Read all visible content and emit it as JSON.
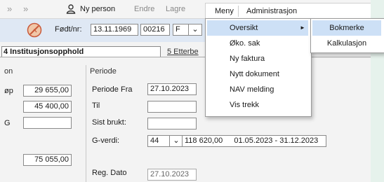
{
  "toolbar": {
    "back_icon": "double-chevron-right-icon",
    "forward_icon": "double-chevron-right-icon",
    "person_icon": "person-icon",
    "new_person": "Ny person",
    "edit": "Endre",
    "save": "Lagre"
  },
  "menubar": {
    "menu": "Meny",
    "admin": "Administrasjon"
  },
  "menu": {
    "items": [
      "Oversikt",
      "Øko. sak",
      "Ny faktura",
      "Nytt dokument",
      "NAV melding",
      "Vis trekk"
    ],
    "arrow": "►"
  },
  "submenu": {
    "items": [
      "Bokmerke",
      "Kalkulasjon"
    ]
  },
  "person": {
    "dob_label": "Født/nr:",
    "dob_value": "13.11.1969",
    "nr_value": "00216",
    "gender_value": "F",
    "dropdown_arrow": "⌄",
    "status_icon": "blocked-icon"
  },
  "tabs": {
    "active": "4 Institusjonsopphold",
    "second": "5 Etterbe"
  },
  "left": {
    "header": "on",
    "labels": [
      "øp",
      "G"
    ],
    "values": [
      "29 655,00",
      "45 400,00",
      "",
      "75 055,00"
    ]
  },
  "periode": {
    "header": "Periode",
    "fra_label": "Periode Fra",
    "fra_value": "27.10.2023",
    "til_label": "Til",
    "til_value": "",
    "sist_label": "Sist brukt:",
    "sist_value": "",
    "gverdi_label": "G-verdi:",
    "gverdi_code": "44",
    "gverdi_amount": "118 620,00",
    "gverdi_range": "01.05.2023 - 31.12.2023",
    "reg_label": "Reg. Dato",
    "reg_value": "27.10.2023"
  },
  "colors": {
    "accent": "#cde0f6",
    "toolbar": "#f4f4f4",
    "page": "#f3f3f3"
  }
}
